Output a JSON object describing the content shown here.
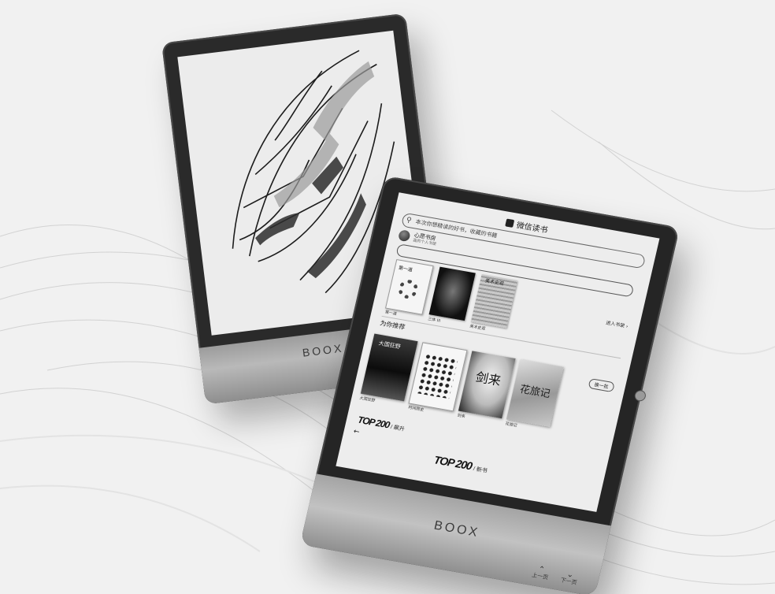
{
  "scene": {
    "background_color": "#f1f1f1",
    "device_body_color": "#252525",
    "device_chin_color": "#b5b5b5"
  },
  "back_device": {
    "brand": "BOOX",
    "screen_content_icon": "mechanical-sketch-illustration"
  },
  "front_device": {
    "brand": "BOOX",
    "app_title": "微信读书",
    "search_placeholder": "本次你想精读的好书，收藏的书籍",
    "profile": {
      "name": "心愿书房",
      "subtitle": "我的个人书架"
    },
    "shelf": [
      {
        "cover_title": "第一道",
        "caption": "第一道"
      },
      {
        "cover_title": "",
        "caption": "三体 III"
      },
      {
        "cover_title": "美术史观",
        "caption": "美术史观"
      }
    ],
    "add_link": "进入书架 ›",
    "section_title": "为你推荐",
    "more_button": "换一批",
    "recommendations": [
      {
        "cover_title": "大国狂野",
        "caption": "大国狂野"
      },
      {
        "cover_title": "",
        "caption": "时间简史"
      },
      {
        "cover_title": "剑来",
        "caption": "剑来"
      },
      {
        "cover_title": "花旅记",
        "caption": "花旅记"
      }
    ],
    "ranking_top": {
      "label": "TOP 200",
      "suffix": "/ 飙升"
    },
    "ranking_bottom": {
      "label": "TOP 200",
      "suffix": "/ 新书"
    },
    "nav_up": "上一页",
    "nav_down": "下一页"
  }
}
